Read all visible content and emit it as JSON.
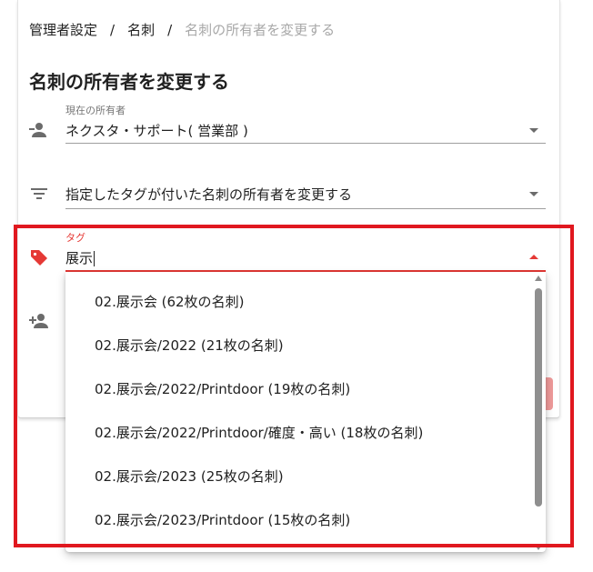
{
  "breadcrumb": {
    "items": [
      "管理者設定",
      "名刺",
      "名刺の所有者を変更する"
    ],
    "separator": "/"
  },
  "page_title": "名刺の所有者を変更する",
  "current_owner": {
    "label": "現在の所有者",
    "value": "ネクスタ・サポート( 営業部 )",
    "icon": "person-remove-icon"
  },
  "change_mode": {
    "value": "指定したタグが付いた名刺の所有者を変更する",
    "icon": "filter-list-icon"
  },
  "tag_field": {
    "label": "タグ",
    "value": "展示",
    "icon": "tag-icon",
    "accent_color": "#e53935"
  },
  "new_owner": {
    "icon": "person-add-icon"
  },
  "dropdown": {
    "options": [
      "02.展示会 (62枚の名刺)",
      "02.展示会/2022 (21枚の名刺)",
      "02.展示会/2022/Printdoor (19枚の名刺)",
      "02.展示会/2022/Printdoor/確度・高い (18枚の名刺)",
      "02.展示会/2023 (25枚の名刺)",
      "02.展示会/2023/Printdoor (15枚の名刺)"
    ]
  },
  "colors": {
    "highlight_box": "#e0181f",
    "accent": "#e53935"
  }
}
